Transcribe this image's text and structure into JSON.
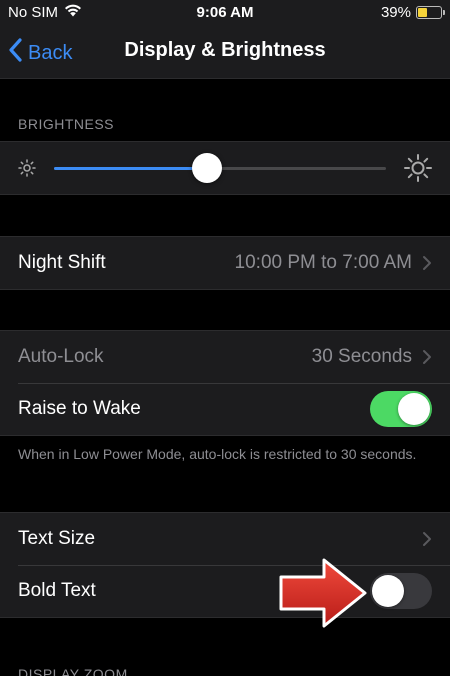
{
  "status_bar": {
    "carrier": "No SIM",
    "time": "9:06 AM",
    "battery_percent": "39%",
    "battery_level": 0.39
  },
  "nav": {
    "back_label": "Back",
    "title": "Display & Brightness"
  },
  "brightness": {
    "header": "BRIGHTNESS",
    "level": 0.46
  },
  "night_shift": {
    "label": "Night Shift",
    "value": "10:00 PM to 7:00 AM"
  },
  "lock_group": {
    "auto_lock_label": "Auto-Lock",
    "auto_lock_value": "30 Seconds",
    "raise_to_wake_label": "Raise to Wake",
    "raise_to_wake_on": true,
    "footer": "When in Low Power Mode, auto-lock is restricted to 30 seconds."
  },
  "text_group": {
    "text_size_label": "Text Size",
    "bold_text_label": "Bold Text",
    "bold_text_on": false
  },
  "display_zoom": {
    "header": "DISPLAY ZOOM"
  },
  "colors": {
    "accent": "#3c8cf5",
    "toggle_on": "#4cd964",
    "annotation_arrow": "#d22a24"
  },
  "icons": [
    "wifi-icon",
    "battery-icon",
    "chevron-left-icon",
    "sun-small-icon",
    "sun-large-icon",
    "chevron-right-icon",
    "red-arrow-annotation"
  ]
}
